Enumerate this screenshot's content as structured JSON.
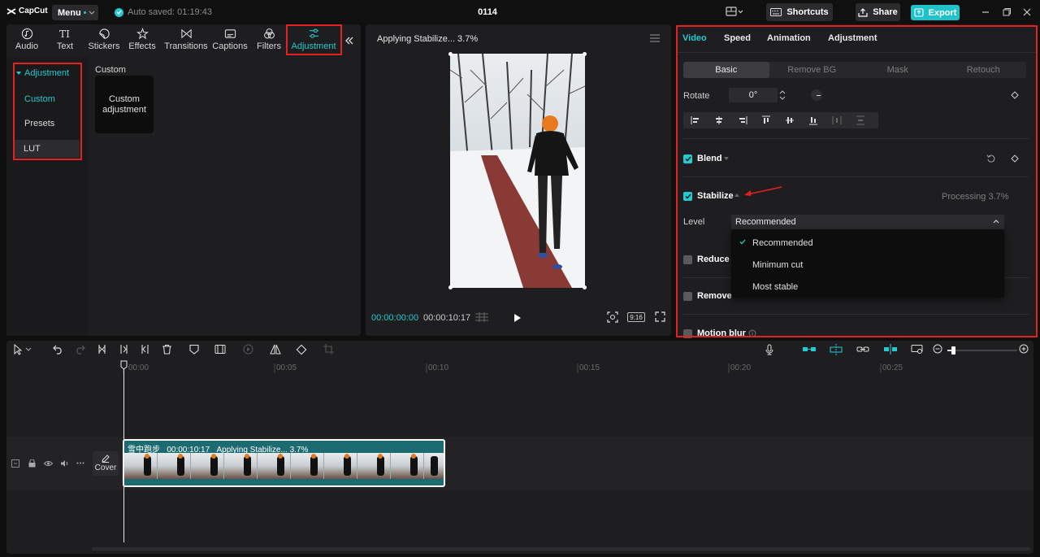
{
  "app": {
    "logo": "CapCut",
    "menu_label": "Menu",
    "autosave": "Auto saved: 01:19:43",
    "project_title": "0114",
    "shortcuts_label": "Shortcuts",
    "share_label": "Share",
    "export_label": "Export",
    "accent_color": "#25c9d0"
  },
  "media": {
    "tabs": [
      {
        "label": "Audio",
        "icon": "audio-icon"
      },
      {
        "label": "Text",
        "icon": "text-icon"
      },
      {
        "label": "Stickers",
        "icon": "sticker-icon"
      },
      {
        "label": "Effects",
        "icon": "effects-icon"
      },
      {
        "label": "Transitions",
        "icon": "transitions-icon"
      },
      {
        "label": "Captions",
        "icon": "captions-icon"
      },
      {
        "label": "Filters",
        "icon": "filters-icon"
      },
      {
        "label": "Adjustment",
        "icon": "adjustment-icon"
      }
    ],
    "sidebar": {
      "header": "Adjustment",
      "items": [
        "Custom",
        "Presets",
        "LUT"
      ]
    },
    "section_title": "Custom",
    "card_label": "Custom adjustment"
  },
  "player": {
    "title": "Applying Stabilize... 3.7%",
    "time_current": "00:00:00:00",
    "time_total": "00:00:10:17",
    "ratio": "9:16"
  },
  "props": {
    "tabs": [
      "Video",
      "Speed",
      "Animation",
      "Adjustment"
    ],
    "subtabs": [
      "Basic",
      "Remove BG",
      "Mask",
      "Retouch"
    ],
    "rotate_label": "Rotate",
    "rotate_value": "0°",
    "blend_label": "Blend",
    "stabilize_label": "Stabilize",
    "stabilize_status": "Processing 3.7%",
    "level_label": "Level",
    "level_value": "Recommended",
    "level_options": [
      "Recommended",
      "Minimum cut",
      "Most stable"
    ],
    "reduce_label": "Reduce",
    "remove_label": "Remove",
    "motion_blur_label": "Motion blur"
  },
  "timeline": {
    "ruler": [
      "00:00",
      "00:05",
      "00:10",
      "00:15",
      "00:20",
      "00:25"
    ],
    "clip_name": "雪中跑步",
    "clip_duration": "00:00:10:17",
    "clip_status": "Applying Stabilize... 3.7%",
    "cover_label": "Cover"
  }
}
